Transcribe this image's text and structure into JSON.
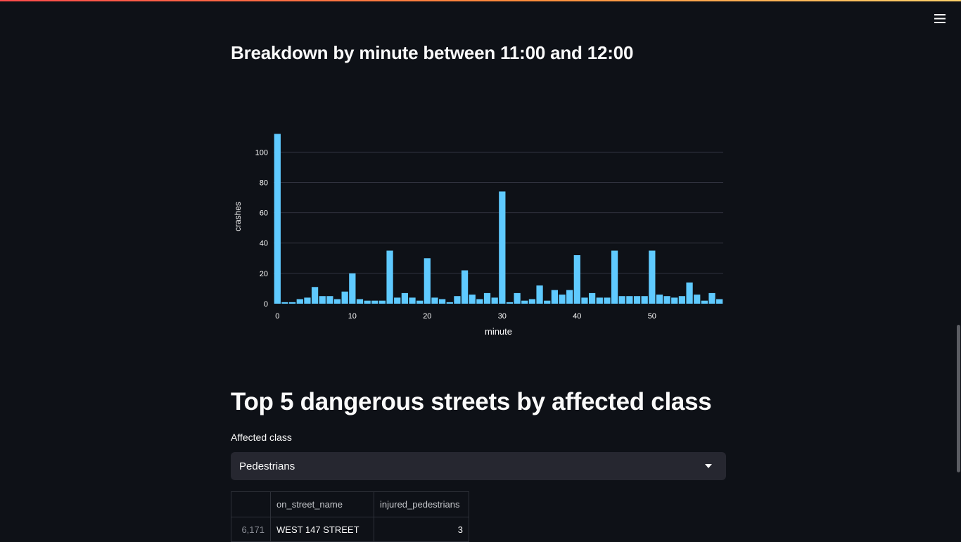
{
  "header": {
    "menu_icon": "hamburger-menu-icon"
  },
  "section_minute": {
    "title": "Breakdown by minute between 11:00 and 12:00"
  },
  "chart_data": {
    "type": "bar",
    "xlabel": "minute",
    "ylabel": "crashes",
    "xlim": [
      0,
      59
    ],
    "ylim": [
      0,
      115
    ],
    "x_ticks": [
      0,
      10,
      20,
      30,
      40,
      50
    ],
    "y_ticks": [
      0,
      20,
      40,
      60,
      80,
      100
    ],
    "grid": true,
    "bar_color": "#5fcaff",
    "categories": [
      0,
      1,
      2,
      3,
      4,
      5,
      6,
      7,
      8,
      9,
      10,
      11,
      12,
      13,
      14,
      15,
      16,
      17,
      18,
      19,
      20,
      21,
      22,
      23,
      24,
      25,
      26,
      27,
      28,
      29,
      30,
      31,
      32,
      33,
      34,
      35,
      36,
      37,
      38,
      39,
      40,
      41,
      42,
      43,
      44,
      45,
      46,
      47,
      48,
      49,
      50,
      51,
      52,
      53,
      54,
      55,
      56,
      57,
      58,
      59
    ],
    "values": [
      112,
      1,
      1,
      3,
      4,
      11,
      5,
      5,
      3,
      8,
      20,
      3,
      2,
      2,
      2,
      35,
      4,
      7,
      4,
      2,
      30,
      4,
      3,
      1,
      5,
      22,
      6,
      3,
      7,
      4,
      74,
      1,
      7,
      2,
      3,
      12,
      2,
      9,
      6,
      9,
      32,
      4,
      7,
      4,
      4,
      35,
      5,
      5,
      5,
      5,
      35,
      6,
      5,
      4,
      5,
      14,
      6,
      2,
      7,
      3
    ]
  },
  "section_streets": {
    "title": "Top 5 dangerous streets by affected class",
    "select_label": "Affected class",
    "select_value": "Pedestrians",
    "select_icon": "chevron-down-icon"
  },
  "table": {
    "columns": [
      "",
      "on_street_name",
      "injured_pedestrians"
    ],
    "rows": [
      {
        "index": "6,171",
        "on_street_name": "WEST 147 STREET",
        "injured_pedestrians": "3"
      }
    ]
  },
  "colors": {
    "background": "#0e1117",
    "text": "#fafafa",
    "select_bg": "#262730",
    "bar": "#5fcaff"
  }
}
